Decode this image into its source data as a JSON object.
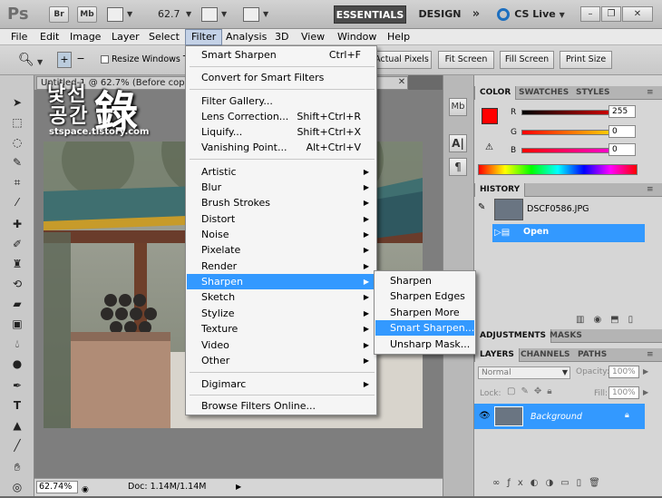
{
  "app": {
    "logo": "Ps",
    "bridge": "Br",
    "minibridge": "Mb",
    "zoom": "62.7",
    "workspaces": [
      "ESSENTIALS",
      "DESIGN"
    ],
    "more": "»",
    "cslive": "CS Live",
    "window_buttons": [
      "–",
      "❐",
      "✕"
    ]
  },
  "menubar": [
    "File",
    "Edit",
    "Image",
    "Layer",
    "Select",
    "Filter",
    "Analysis",
    "3D",
    "View",
    "Window",
    "Help"
  ],
  "options": {
    "resize_label": "Resize Windows To",
    "buttons": [
      "Actual Pixels",
      "Fit Screen",
      "Fill Screen",
      "Print Size"
    ]
  },
  "document": {
    "tab_title": "Untitled-1 @ 62.7% (Before copy 2, RGB/8)",
    "close": "✕",
    "zoom": "62.74%",
    "doc_info": "Doc: 1.14M/1.14M"
  },
  "watermark": {
    "line1": "낯선",
    "line2": "공간",
    "big": "錄",
    "url": "stspace.tistory.com"
  },
  "filter_menu": {
    "top": [
      {
        "label": "Smart Sharpen",
        "shortcut": "Ctrl+F"
      },
      {
        "label": "Convert for Smart Filters",
        "shortcut": ""
      }
    ],
    "middle": [
      {
        "label": "Filter Gallery...",
        "shortcut": ""
      },
      {
        "label": "Lens Correction...",
        "shortcut": "Shift+Ctrl+R"
      },
      {
        "label": "Liquify...",
        "shortcut": "Shift+Ctrl+X"
      },
      {
        "label": "Vanishing Point...",
        "shortcut": "Alt+Ctrl+V"
      }
    ],
    "groups": [
      "Artistic",
      "Blur",
      "Brush Strokes",
      "Distort",
      "Noise",
      "Pixelate",
      "Render",
      "Sharpen",
      "Sketch",
      "Stylize",
      "Texture",
      "Video",
      "Other"
    ],
    "digimarc": "Digimarc",
    "browse": "Browse Filters Online..."
  },
  "sharpen_submenu": [
    "Sharpen",
    "Sharpen Edges",
    "Sharpen More",
    "Smart Sharpen...",
    "Unsharp Mask..."
  ],
  "color_panel": {
    "tabs": [
      "COLOR",
      "SWATCHES",
      "STYLES"
    ],
    "r_label": "R",
    "g_label": "G",
    "b_label": "B",
    "r": "255",
    "g": "0",
    "b": "0",
    "fg_color": "#ff0000"
  },
  "history_panel": {
    "tab": "HISTORY",
    "snapshot": "DSCF0586.JPG",
    "state": "Open"
  },
  "adjust_tabs": [
    "ADJUSTMENTS",
    "MASKS"
  ],
  "layers_panel": {
    "tabs": [
      "LAYERS",
      "CHANNELS",
      "PATHS"
    ],
    "blend_mode": "Normal",
    "opacity_label": "Opacity:",
    "opacity": "100%",
    "lock_label": "Lock:",
    "fill_label": "Fill:",
    "fill": "100%",
    "layer_name": "Background"
  },
  "colors": {
    "highlight": "#3399ff",
    "essentials_bg": "#4b4b4b"
  }
}
